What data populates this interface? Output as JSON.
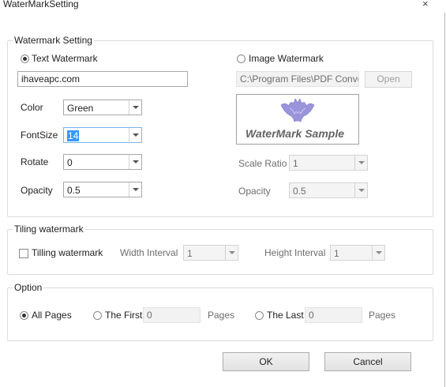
{
  "window": {
    "title": "WaterMarkSetting",
    "close_icon": "×"
  },
  "watermark_setting": {
    "legend": "Watermark Setting",
    "text_watermark_label": "Text Watermark",
    "text_value": "ihaveapc.com",
    "color_label": "Color",
    "color_value": "Green",
    "fontsize_label": "FontSize",
    "fontsize_value": "14",
    "rotate_label": "Rotate",
    "rotate_value": "0",
    "opacity_label": "Opacity",
    "opacity_value": "0.5",
    "image_watermark_label": "Image Watermark",
    "image_path": "C:\\Program Files\\PDF Convert",
    "open_label": "Open",
    "preview_text": "WaterMark Sample",
    "scale_ratio_label": "Scale Ratio",
    "scale_ratio_value": "1",
    "image_opacity_label": "Opacity",
    "image_opacity_value": "0.5"
  },
  "tiling": {
    "legend": "Tiling watermark",
    "checkbox_label": "Tilling watermark",
    "width_label": "Width Interval",
    "width_value": "1",
    "height_label": "Height Interval",
    "height_value": "1"
  },
  "option": {
    "legend": "Option",
    "all_pages": "All Pages",
    "the_first": "The First",
    "first_value": "0",
    "pages_label_1": "Pages",
    "the_last": "The Last",
    "last_value": "0",
    "pages_label_2": "Pages"
  },
  "buttons": {
    "ok": "OK",
    "cancel": "Cancel"
  }
}
